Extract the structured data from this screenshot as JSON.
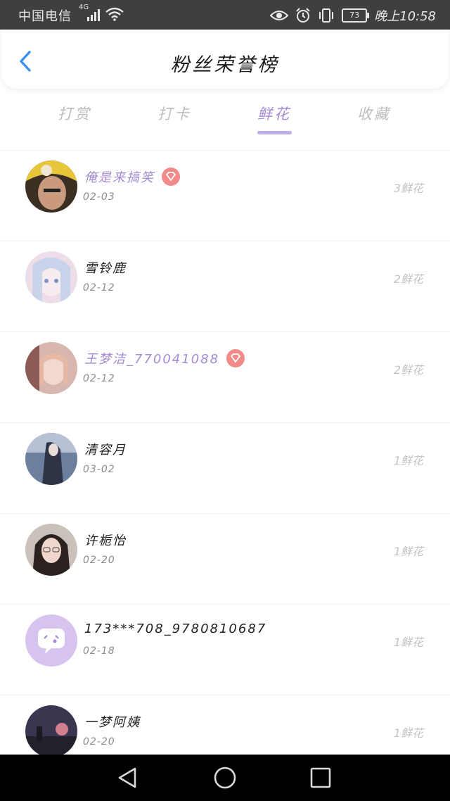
{
  "status_bar": {
    "carrier": "中国电信",
    "network": "4G",
    "battery": "73",
    "time": "晚上10:58"
  },
  "header": {
    "title": "粉丝荣誉榜"
  },
  "tabs": [
    {
      "label": "打赏",
      "active": false
    },
    {
      "label": "打卡",
      "active": false
    },
    {
      "label": "鲜花",
      "active": true
    },
    {
      "label": "收藏",
      "active": false
    }
  ],
  "colors": {
    "accent": "#a48ad3",
    "indicator": "#c2aee6",
    "vip_badge": "#f28a8a",
    "status_bar": "#3f3f3f"
  },
  "fans": [
    {
      "name": "俺是来搞笑",
      "date": "02-03",
      "count": "3鲜花",
      "vip": true
    },
    {
      "name": "雪铃鹿",
      "date": "02-12",
      "count": "2鲜花",
      "vip": false
    },
    {
      "name": "王梦洁_770041088",
      "date": "02-12",
      "count": "2鲜花",
      "vip": true
    },
    {
      "name": "清容月",
      "date": "03-02",
      "count": "1鲜花",
      "vip": false
    },
    {
      "name": "许栀怡",
      "date": "02-20",
      "count": "1鲜花",
      "vip": false
    },
    {
      "name": "173***708_9780810687",
      "date": "02-18",
      "count": "1鲜花",
      "vip": false
    },
    {
      "name": "一梦阿姨",
      "date": "02-20",
      "count": "1鲜花",
      "vip": false
    }
  ]
}
